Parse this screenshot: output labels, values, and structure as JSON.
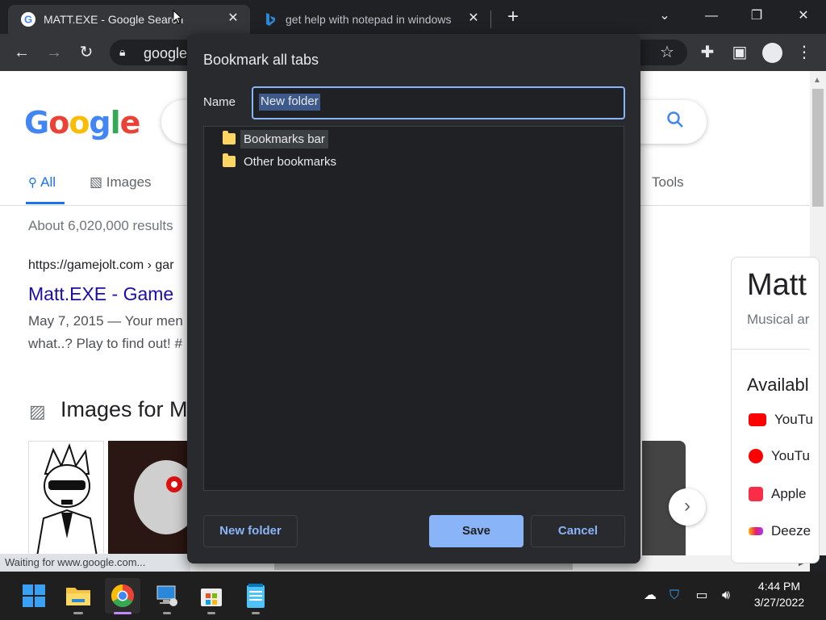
{
  "browser": {
    "tabs": [
      {
        "title": "MATT.EXE - Google Search"
      },
      {
        "title": "get help with notepad in windows"
      }
    ],
    "address": "google",
    "status_text": "Waiting for www.google.com..."
  },
  "google": {
    "logo": "Google",
    "nav": {
      "all": "All",
      "images": "Images",
      "tools": "Tools"
    },
    "result_count": "About 6,020,000 results",
    "result": {
      "url": "https://gamejolt.com › gar",
      "title": "Matt.EXE - Game",
      "snippet_1": "May 7, 2015 — Your men",
      "snippet_2": "what..? Play to find out! #"
    },
    "images_heading": "Images for M",
    "knowledge_panel": {
      "title": "Matt",
      "subtitle": "Musical ar",
      "available_heading": "Availabl",
      "services": [
        {
          "label": "YouTu",
          "color": "#ff0000"
        },
        {
          "label": "YouTu",
          "color": "#ff0000"
        },
        {
          "label": "Apple",
          "color": "#fa2d48"
        },
        {
          "label": "Deeze",
          "color": "#a238ff"
        }
      ]
    }
  },
  "dialog": {
    "title": "Bookmark all tabs",
    "name_label": "Name",
    "name_value": "New folder",
    "folders": [
      {
        "label": "Bookmarks bar"
      },
      {
        "label": "Other bookmarks"
      }
    ],
    "buttons": {
      "new_folder": "New folder",
      "save": "Save",
      "cancel": "Cancel"
    }
  },
  "taskbar": {
    "time": "4:44 PM",
    "date": "3/27/2022",
    "apps": [
      "start-icon",
      "file-explorer-icon",
      "chrome-icon",
      "network-pc-icon",
      "store-icon",
      "notepad-icon"
    ]
  },
  "colors": {
    "accent": "#8ab4f8",
    "dialog_bg": "#292a2d",
    "link": "#1a0dab"
  }
}
